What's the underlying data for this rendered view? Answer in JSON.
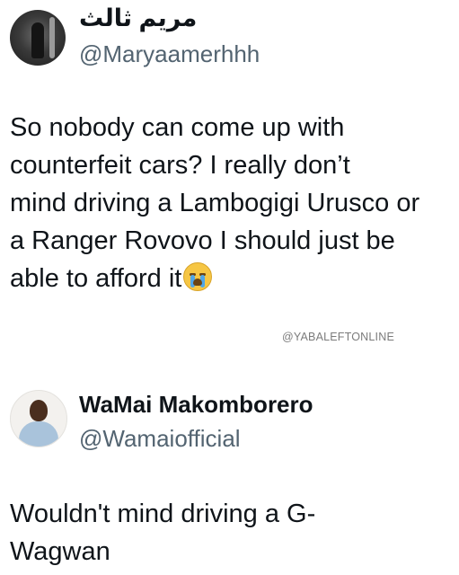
{
  "tweets": [
    {
      "display_name": "مريم ثالث",
      "handle": "@Maryaamerhhh",
      "text_lines": [
        "So nobody can come up with",
        "counterfeit cars? I really don’t",
        "mind driving a Lambogigi Urusco or",
        "a Ranger Rovovo I should just be",
        "able to afford it"
      ],
      "emoji": "loudly-crying-face"
    },
    {
      "display_name": "WaMai Makomborero",
      "handle": "@Wamaiofficial",
      "text_lines": [
        "Wouldn't mind driving a G-",
        "Wagwan"
      ]
    }
  ],
  "watermark": "@YABALEFTONLINE",
  "colors": {
    "text": "#0f1419",
    "secondary": "#536471",
    "watermark": "#7b7b7b",
    "background": "#ffffff"
  }
}
